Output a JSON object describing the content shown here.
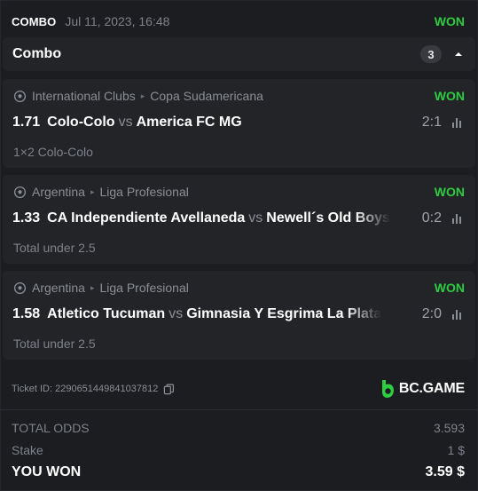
{
  "header": {
    "bet_type": "COMBO",
    "date": "Jul 11, 2023, 16:48",
    "status": "WON"
  },
  "combo": {
    "title": "Combo",
    "count": "3"
  },
  "bets": [
    {
      "region": "International Clubs",
      "league": "Copa Sudamericana",
      "result": "WON",
      "odds": "1.71",
      "home": "Colo-Colo",
      "vs": "vs",
      "away": "America FC MG",
      "score": "2:1",
      "market": "1×2 Colo-Colo"
    },
    {
      "region": "Argentina",
      "league": "Liga Profesional",
      "result": "WON",
      "odds": "1.33",
      "home": "CA Independiente Avellaneda",
      "vs": "vs",
      "away": "Newell´s Old Boys",
      "score": "0:2",
      "market": "Total under 2.5"
    },
    {
      "region": "Argentina",
      "league": "Liga Profesional",
      "result": "WON",
      "odds": "1.58",
      "home": "Atletico Tucuman",
      "vs": "vs",
      "away": "Gimnasia Y Esgrima La Plata",
      "score": "2:0",
      "market": "Total under 2.5"
    }
  ],
  "ticket": {
    "id_text": "Ticket ID: 2290651449841037812",
    "brand": "BC.GAME"
  },
  "summary": {
    "total_odds_label": "TOTAL ODDS",
    "total_odds": "3.593",
    "stake_label": "Stake",
    "stake": "1 $",
    "won_label": "YOU WON",
    "won": "3.59 $"
  },
  "colors": {
    "won": "#2ecc40",
    "brand": "#2ecc40",
    "background": "#1c1d21",
    "panel": "#232428"
  },
  "icons": {
    "collapse": "caret-up-icon",
    "sport": "soccer-ball-icon",
    "stats": "bar-chart-icon",
    "copy": "copy-icon",
    "brand_logo": "bc-game-logo"
  }
}
